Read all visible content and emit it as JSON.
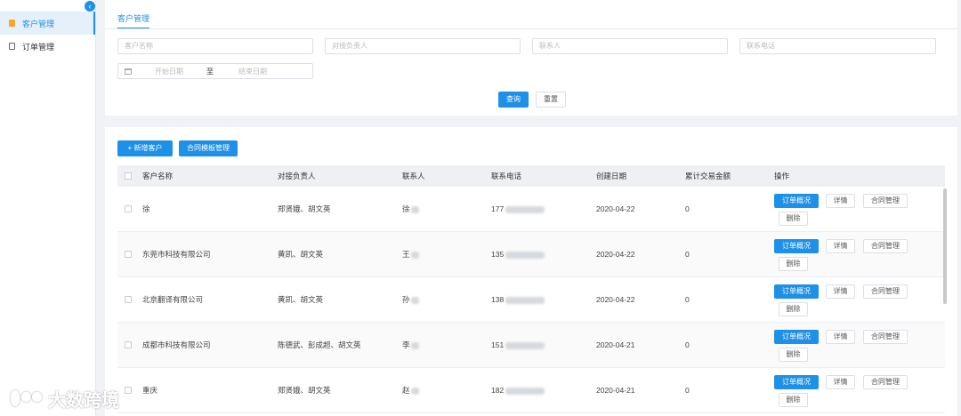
{
  "sidebar": {
    "items": [
      {
        "label": "客户管理"
      },
      {
        "label": "订单管理"
      }
    ]
  },
  "tab": {
    "label": "客户管理"
  },
  "search": {
    "customer_placeholder": "客户名称",
    "owner_placeholder": "对接负责人",
    "contact_placeholder": "联系人",
    "phone_placeholder": "联系电话",
    "start_placeholder": "开始日期",
    "to": "至",
    "end_placeholder": "结束日期",
    "query_label": "查询",
    "reset_label": "重置"
  },
  "toolbar": {
    "add_label": "+ 新增客户",
    "template_label": "合同模板管理"
  },
  "table": {
    "headers": {
      "name": "客户名称",
      "owner": "对接负责人",
      "contact": "联系人",
      "phone": "联系电话",
      "date": "创建日期",
      "amount": "累计交易金额",
      "ops": "操作"
    },
    "ops": {
      "orders": "订单概况",
      "detail": "详情",
      "contract": "合同管理",
      "delete": "删除"
    },
    "rows": [
      {
        "name": "徐",
        "owner": "郑贤娥、胡文英",
        "contact": "徐",
        "phone": "177",
        "date": "2020-04-22",
        "amount": "0"
      },
      {
        "name": "东莞市科技有限公司",
        "owner": "黄凯、胡文英",
        "contact": "王",
        "phone": "135",
        "date": "2020-04-22",
        "amount": "0"
      },
      {
        "name": "北京翻译有限公司",
        "owner": "黄凯、胡文英",
        "contact": "孙",
        "phone": "138",
        "date": "2020-04-22",
        "amount": "0"
      },
      {
        "name": "成都市科技有限公司",
        "owner": "陈德武、彭成超、胡文英",
        "contact": "李",
        "phone": "151",
        "date": "2020-04-21",
        "amount": "0"
      },
      {
        "name": "重庆",
        "owner": "郑贤娥、胡文英",
        "contact": "赵",
        "phone": "182",
        "date": "2020-04-21",
        "amount": "0"
      }
    ]
  },
  "watermark": {
    "text": "大数跨境"
  },
  "colors": {
    "accent": "#1e90e8",
    "active_bg": "#e6f0fb"
  }
}
